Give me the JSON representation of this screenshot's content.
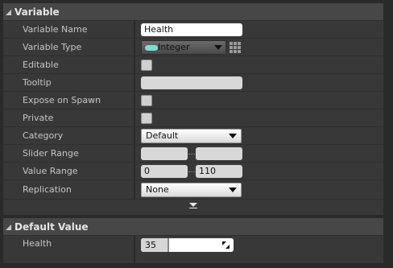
{
  "variable_section": {
    "title": "Variable",
    "rows": {
      "name": {
        "label": "Variable Name",
        "value": "Health"
      },
      "type": {
        "label": "Variable Type",
        "value": "Integer",
        "pill_color": "#7fdccf"
      },
      "editable": {
        "label": "Editable",
        "checked": false
      },
      "tooltip": {
        "label": "Tooltip",
        "value": ""
      },
      "expose": {
        "label": "Expose on Spawn",
        "checked": false
      },
      "private": {
        "label": "Private",
        "checked": false
      },
      "category": {
        "label": "Category",
        "value": "Default"
      },
      "slider_range": {
        "label": "Slider Range",
        "min": "",
        "max": ""
      },
      "value_range": {
        "label": "Value Range",
        "min": "0",
        "max": "110"
      },
      "replication": {
        "label": "Replication",
        "value": "None"
      }
    }
  },
  "default_section": {
    "title": "Default Value",
    "health": {
      "label": "Health",
      "value": "35",
      "fill_fraction": 0.3
    }
  },
  "colors": {
    "background": "#2a2a2a",
    "panel": "#383838",
    "header": "#474747",
    "integer_pin": "#7fdccf"
  },
  "icons": {
    "collapse": "collapse-triangle-icon",
    "dropdown": "chevron-down-icon",
    "grid": "container-grid-icon",
    "expand": "expand-advanced-icon",
    "resize": "resize-corner-icon"
  }
}
